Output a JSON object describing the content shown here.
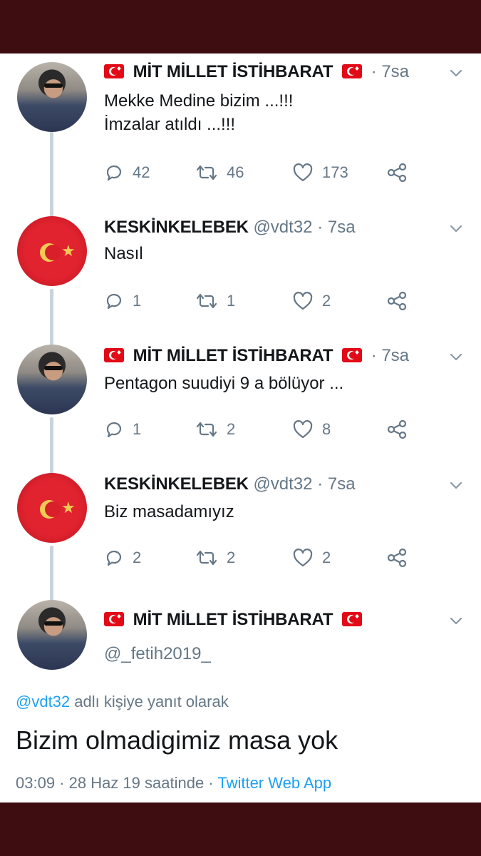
{
  "tweets": [
    {
      "name": "MİT MİLLET İSTİHBARAT",
      "handle": "",
      "time": "· 7sa",
      "text": "Mekke Medine bizim ...!!!\nİmzalar atıldı ...!!!",
      "reply": "42",
      "retweet": "46",
      "like": "173",
      "avatar": "person",
      "flags": true
    },
    {
      "name": "KESKİNKELEBEK",
      "handle": "@vdt32",
      "time": "· 7sa",
      "text": "Nasıl",
      "reply": "1",
      "retweet": "1",
      "like": "2",
      "avatar": "flag",
      "flags": false
    },
    {
      "name": "MİT MİLLET İSTİHBARAT",
      "handle": "",
      "time": "· 7sa",
      "text": "Pentagon suudiyi 9 a bölüyor ...",
      "reply": "1",
      "retweet": "2",
      "like": "8",
      "avatar": "person",
      "flags": true
    },
    {
      "name": "KESKİNKELEBEK",
      "handle": "@vdt32",
      "time": "· 7sa",
      "text": "Biz masadamıyız",
      "reply": "2",
      "retweet": "2",
      "like": "2",
      "avatar": "flag",
      "flags": false
    }
  ],
  "main": {
    "name": "MİT MİLLET İSTİHBARAT",
    "handle": "@_fetih2019_",
    "replying_handle": "@vdt32",
    "replying_text": "adlı kişiye yanıt olarak",
    "text": "Bizim olmadigimiz masa yok",
    "timestamp": "03:09 · 28 Haz 19 saatinde ·",
    "source": "Twitter Web App"
  },
  "colors": {
    "frame": "#3d0d12",
    "accent": "#1da1f2",
    "muted": "#657786",
    "thread_line": "#c9d3dc"
  },
  "icons": [
    "reply-icon",
    "retweet-icon",
    "like-icon",
    "share-icon",
    "chevron-down-icon",
    "turkish-flag-icon"
  ]
}
